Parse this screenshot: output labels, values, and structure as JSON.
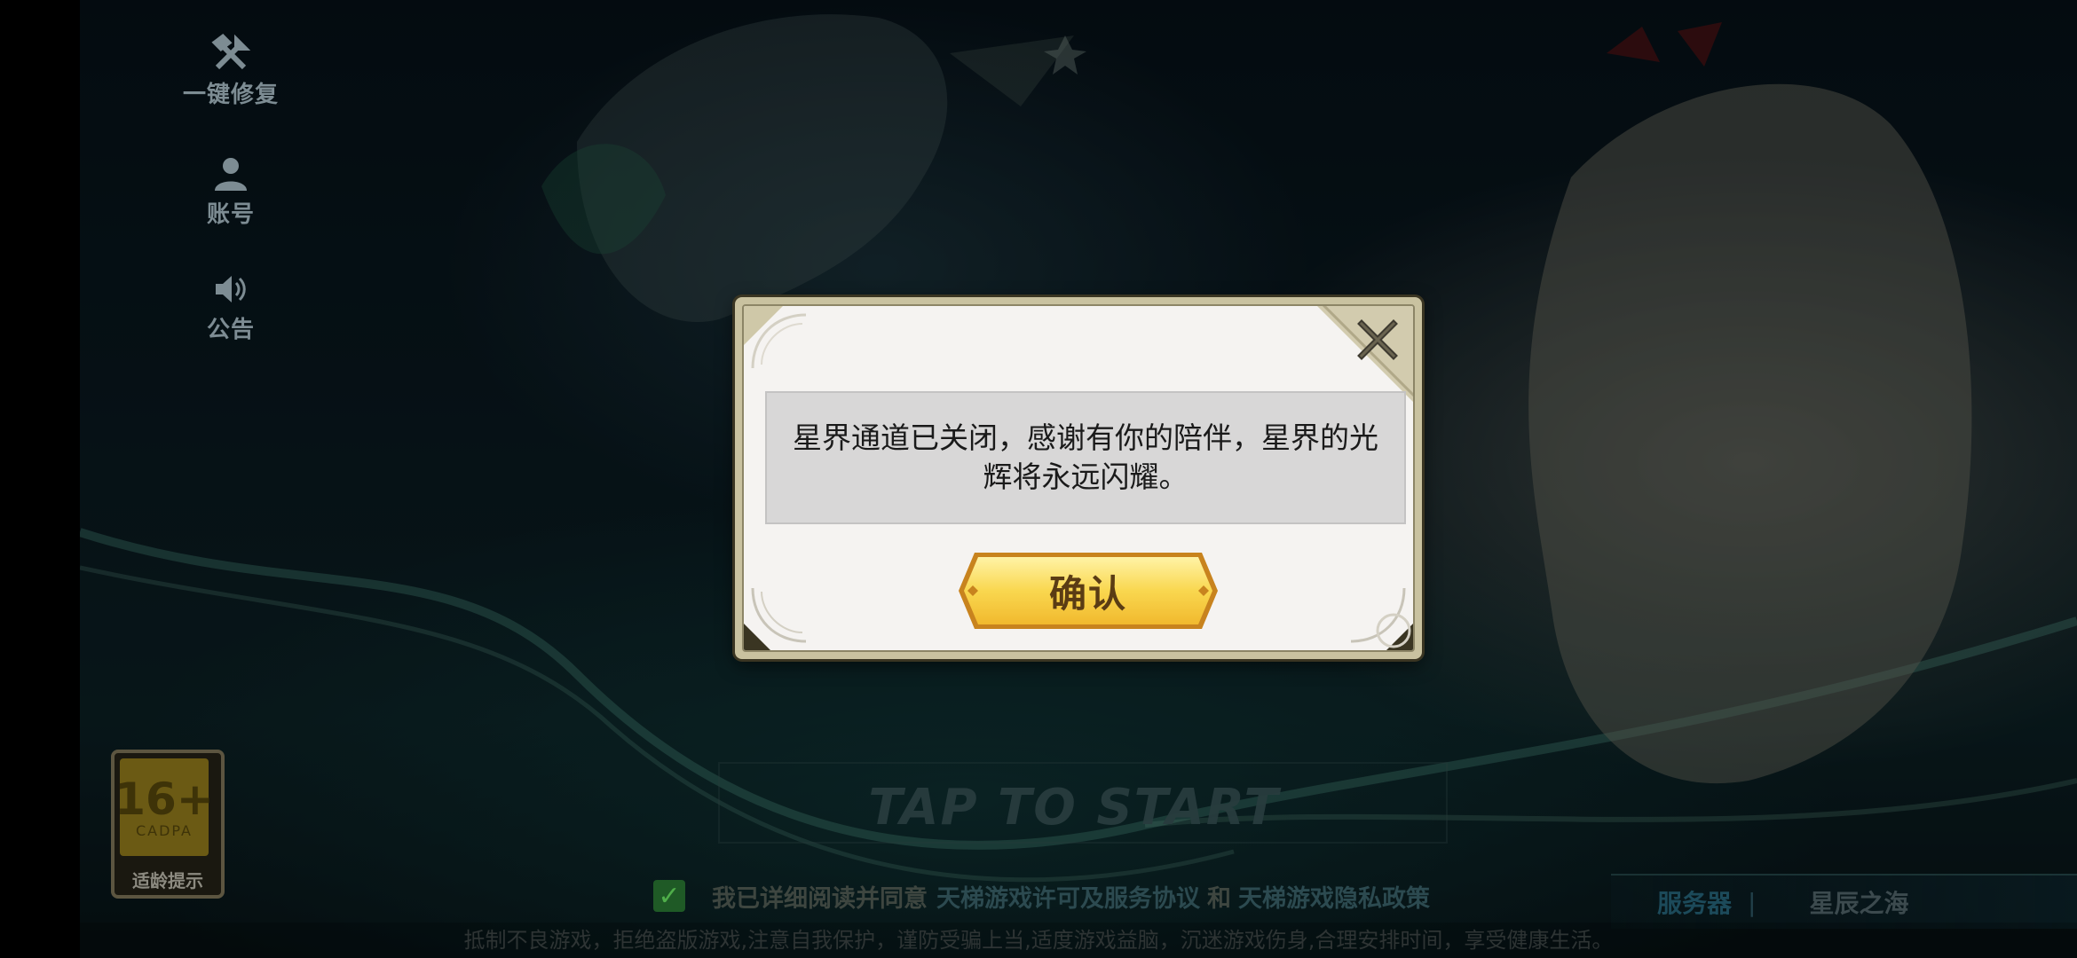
{
  "side_menu": [
    {
      "label": "一键修复",
      "icon": "wrench-hammer-icon"
    },
    {
      "label": "账号",
      "icon": "user-icon"
    },
    {
      "label": "公告",
      "icon": "speaker-icon"
    }
  ],
  "age_badge": {
    "rating": "16+",
    "org": "CADPA",
    "caption": "适龄提示"
  },
  "tap_to_start": "TAP TO START",
  "agreement": {
    "checked": true,
    "prefix": "我已详细阅读并同意",
    "link1": "天梯游戏许可及服务协议",
    "and": "和",
    "link2": "天梯游戏隐私政策"
  },
  "server": {
    "label": "服务器",
    "separator": "|",
    "name": "星辰之海"
  },
  "health_notice": "抵制不良游戏，拒绝盗版游戏,注意自我保护，谨防受骗上当,适度游戏益脑，沉迷游戏伤身,合理安排时间，享受健康生活。",
  "dialog": {
    "message": "星界通道已关闭，感谢有你的陪伴，星界的光辉将永远闪耀。",
    "confirm_label": "确认"
  },
  "colors": {
    "dialog_bg": "#f5f3f1",
    "message_bg": "#d8d7d7",
    "button_gold": "#f7cf45",
    "frame": "#c9c2a0"
  }
}
